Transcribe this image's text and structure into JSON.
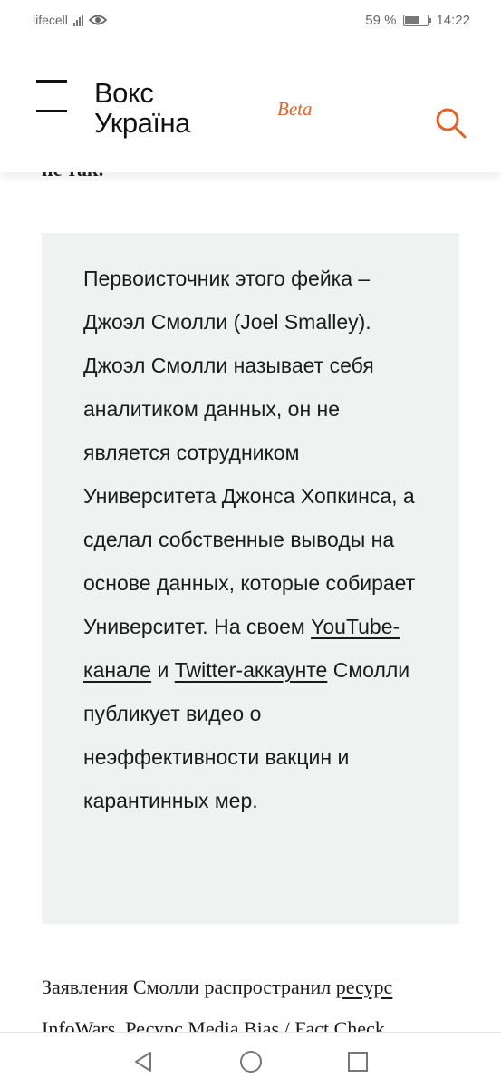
{
  "status_bar": {
    "carrier": "lifecell",
    "battery_percent": "59 %",
    "battery_level": 0.59,
    "time": "14:22",
    "icons": [
      "signal-icon",
      "eye-icon",
      "battery-icon"
    ]
  },
  "header": {
    "logo_line1": "Вокс",
    "logo_line2": "Україна",
    "beta_label": "Beta",
    "accent_color": "#e4622a",
    "icons": [
      "menu-icon",
      "search-icon"
    ]
  },
  "article": {
    "cut_text": "не так.",
    "callout": {
      "text_1": "Первоисточник этого фейка – Джоэл Смолли (Joel Smalley). Джоэл Смолли называет себя аналитиком данных, он не является сотрудником Университета Джонса Хопкинса, а сделал собственные выводы на основе данных, которые собирает Университет. На своем ",
      "link_1": "YouTube-канале",
      "text_2": " и ",
      "link_2": "Twitter-аккаунте",
      "text_3": " Смолли публикует видео о неэффективности вакцин и карантинных мер.",
      "background": "#eef2f1"
    },
    "paragraph": {
      "text_1": "Заявления Смолли распространил ",
      "link_1": "ресурс",
      "text_2": " InfoWars. Ресурс Media Bias / Fact Check"
    }
  },
  "nav_bar": {
    "icons": [
      "back-icon",
      "home-icon",
      "recents-icon"
    ]
  }
}
